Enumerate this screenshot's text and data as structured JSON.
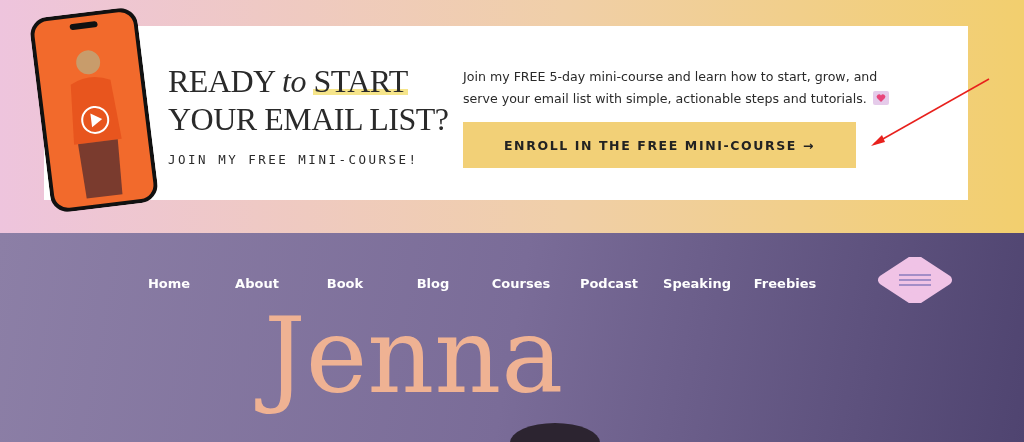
{
  "banner": {
    "headline": {
      "before": "READY",
      "italic": "to",
      "highlighted": "START",
      "second_line": "YOUR EMAIL LIST?"
    },
    "subheading": "JOIN MY FREE MINI-COURSE!",
    "description": "Join my FREE 5-day mini-course and learn how to start, grow, and serve your email list with simple, actionable steps and tutorials.",
    "button": "ENROLL IN THE FREE MINI-COURSE →"
  },
  "nav": {
    "items": [
      "Home",
      "About",
      "Book",
      "Blog",
      "Courses",
      "Podcast",
      "Speaking",
      "Freebies"
    ]
  },
  "hero": {
    "title": "Jenna"
  }
}
